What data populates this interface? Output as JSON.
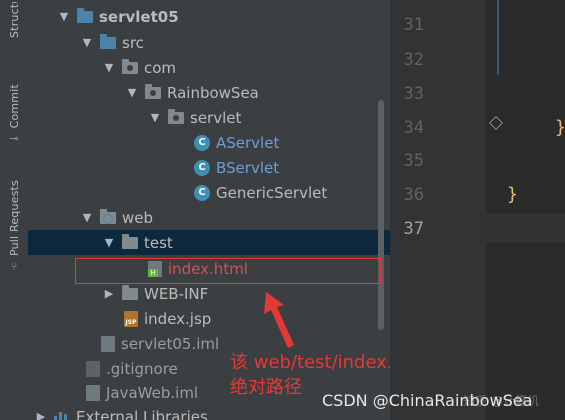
{
  "strip": {
    "structure_label": "Structure",
    "commit_label": "Commit",
    "pull_requests_label": "Pull Requests"
  },
  "tree": {
    "items": [
      {
        "label": "servlet05",
        "icon": "module-folder-icon",
        "expanded": true
      },
      {
        "label": "src",
        "icon": "source-folder-icon",
        "expanded": true
      },
      {
        "label": "com",
        "icon": "package-icon",
        "expanded": true
      },
      {
        "label": "RainbowSea",
        "icon": "package-icon",
        "expanded": true
      },
      {
        "label": "servlet",
        "icon": "package-icon",
        "expanded": true
      },
      {
        "label": "AServlet",
        "icon": "java-class-icon",
        "badge": "C"
      },
      {
        "label": "BServlet",
        "icon": "java-class-icon",
        "badge": "C"
      },
      {
        "label": "GenericServlet",
        "icon": "java-class-icon",
        "badge": "C"
      },
      {
        "label": "web",
        "icon": "web-folder-icon",
        "expanded": true
      },
      {
        "label": "test",
        "icon": "folder-icon",
        "expanded": true,
        "selected": true
      },
      {
        "label": "index.html",
        "icon": "html-file-icon",
        "badge": "H"
      },
      {
        "label": "WEB-INF",
        "icon": "folder-icon",
        "expanded": false
      },
      {
        "label": "index.jsp",
        "icon": "jsp-file-icon",
        "badge": "JSP"
      },
      {
        "label": "servlet05.iml",
        "icon": "iml-file-icon"
      },
      {
        "label": ".gitignore",
        "icon": "gitignore-file-icon"
      },
      {
        "label": "JavaWeb.iml",
        "icon": "iml-file-icon"
      },
      {
        "label": "External Libraries",
        "icon": "libraries-icon",
        "expanded": false
      }
    ]
  },
  "annotation": {
    "line1": "该 web/test/index.html 文件的",
    "line2": "绝对路径"
  },
  "editor": {
    "line_numbers": [
      "31",
      "32",
      "33",
      "34",
      "35",
      "36",
      "37"
    ],
    "current_line": "37",
    "brace_34": "}",
    "brace_36": "}"
  },
  "watermark": {
    "text": "CSDN @ChinaRainbowSea",
    "faint": "知乎 @计算机"
  },
  "colors": {
    "panel": "#3c3f41",
    "selected_row": "#0d293e",
    "annotation_red": "#e53935",
    "class_blue": "#6e9ed8",
    "brace_yellow": "#e8bf6a"
  }
}
